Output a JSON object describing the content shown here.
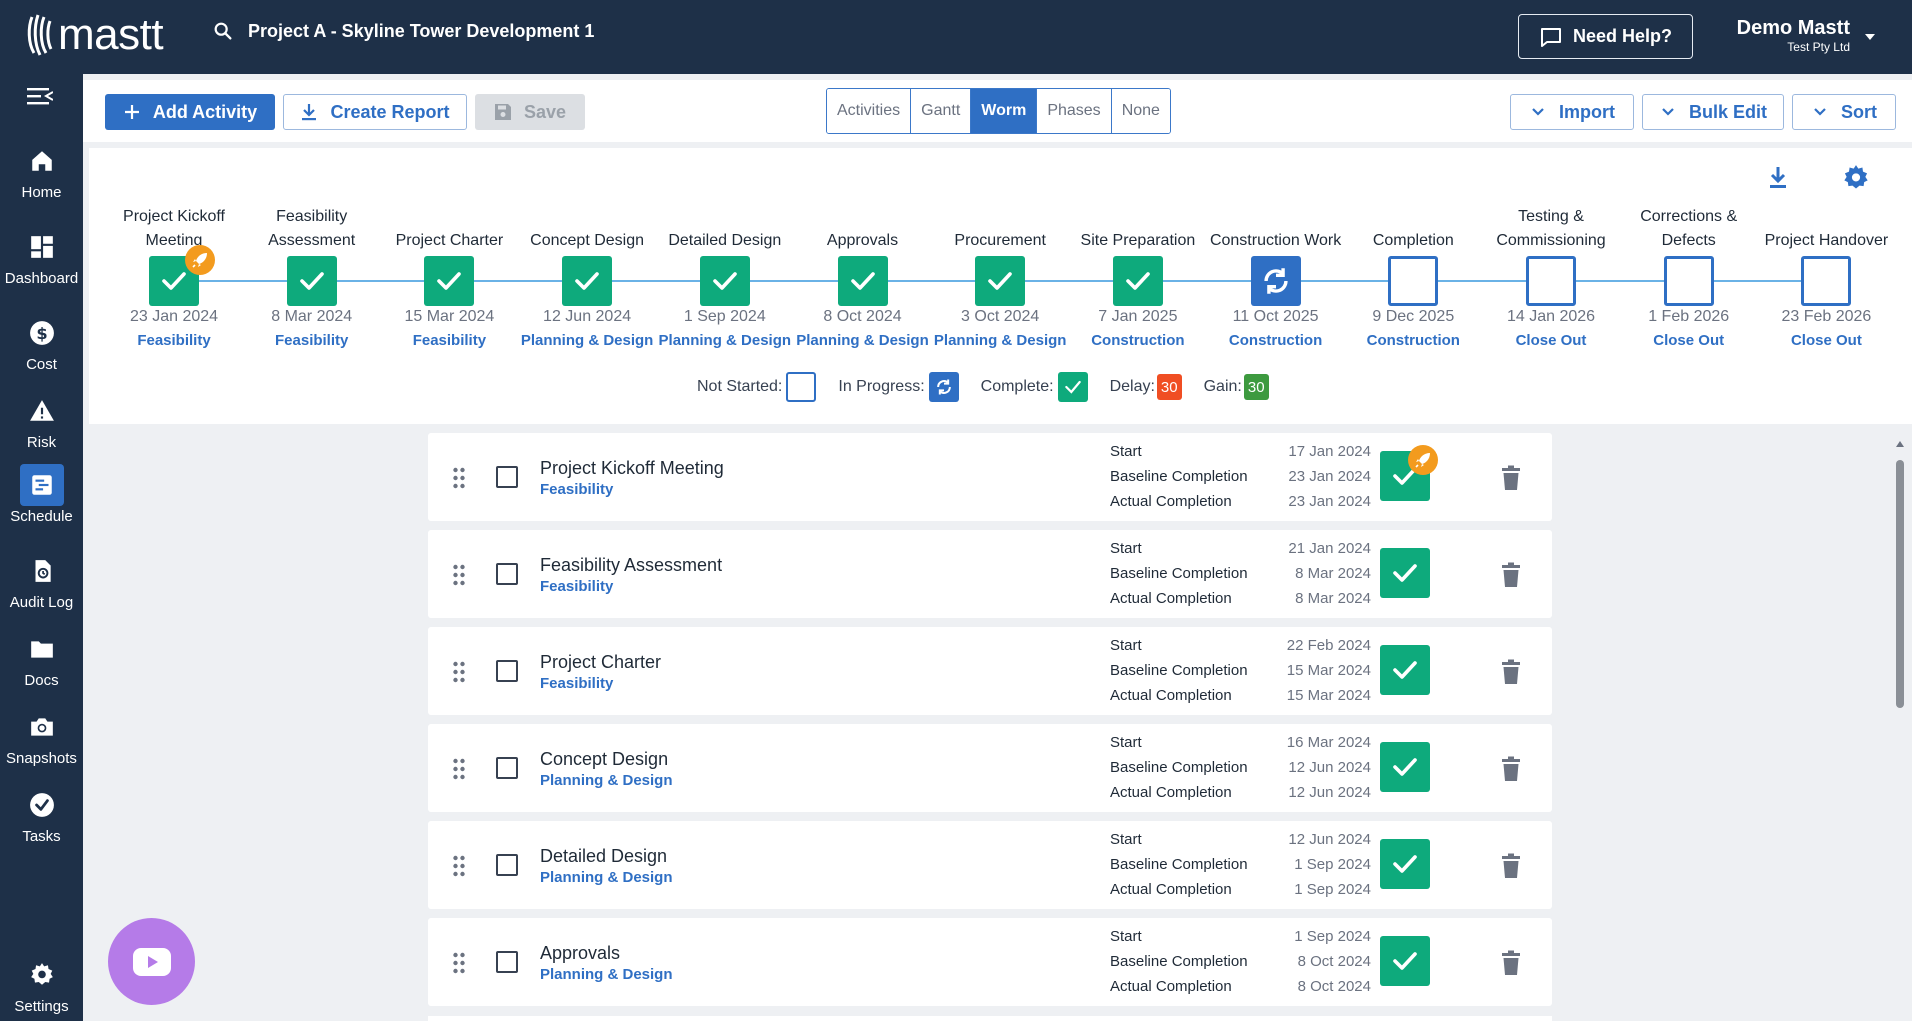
{
  "app": {
    "logo_text": "mastt"
  },
  "header": {
    "project_title": "Project A - Skyline Tower Development 1",
    "help_label": "Need Help?",
    "user_name": "Demo Mastt",
    "user_company": "Test Pty Ltd"
  },
  "sidebar": {
    "items": [
      {
        "label": "Home",
        "icon": "home-icon"
      },
      {
        "label": "Dashboard",
        "icon": "dashboard-icon"
      },
      {
        "label": "Cost",
        "icon": "dollar-icon"
      },
      {
        "label": "Risk",
        "icon": "warning-icon"
      },
      {
        "label": "Schedule",
        "icon": "schedule-icon",
        "active": true
      },
      {
        "label": "Audit Log",
        "icon": "audit-log-icon"
      },
      {
        "label": "Docs",
        "icon": "folder-icon"
      },
      {
        "label": "Snapshots",
        "icon": "camera-icon"
      },
      {
        "label": "Tasks",
        "icon": "check-circle-icon"
      },
      {
        "label": "Settings",
        "icon": "gear-icon"
      }
    ]
  },
  "toolbar": {
    "add_activity": "Add Activity",
    "create_report": "Create Report",
    "save": "Save",
    "views": [
      "Activities",
      "Gantt",
      "Worm",
      "Phases",
      "None"
    ],
    "active_view": "Worm",
    "import": "Import",
    "bulk_edit": "Bulk Edit",
    "sort": "Sort"
  },
  "worm": {
    "milestones": [
      {
        "title": "Project Kickoff Meeting",
        "date": "23 Jan 2024",
        "phase": "Feasibility",
        "status": "complete",
        "rocket": true
      },
      {
        "title": "Feasibility Assessment",
        "date": "8 Mar 2024",
        "phase": "Feasibility",
        "status": "complete"
      },
      {
        "title": "Project Charter",
        "date": "15 Mar 2024",
        "phase": "Feasibility",
        "status": "complete"
      },
      {
        "title": "Concept Design",
        "date": "12 Jun 2024",
        "phase": "Planning & Design",
        "status": "complete"
      },
      {
        "title": "Detailed Design",
        "date": "1 Sep 2024",
        "phase": "Planning & Design",
        "status": "complete"
      },
      {
        "title": "Approvals",
        "date": "8 Oct 2024",
        "phase": "Planning & Design",
        "status": "complete"
      },
      {
        "title": "Procurement",
        "date": "3 Oct 2024",
        "phase": "Planning & Design",
        "status": "complete"
      },
      {
        "title": "Site Preparation",
        "date": "7 Jan 2025",
        "phase": "Construction",
        "status": "complete"
      },
      {
        "title": "Construction Work",
        "date": "11 Oct 2025",
        "phase": "Construction",
        "status": "in-progress"
      },
      {
        "title": "Completion",
        "date": "9 Dec 2025",
        "phase": "Construction",
        "status": "not-started"
      },
      {
        "title": "Testing & Commissioning",
        "date": "14 Jan 2026",
        "phase": "Close Out",
        "status": "not-started"
      },
      {
        "title": "Corrections & Defects",
        "date": "1 Feb 2026",
        "phase": "Close Out",
        "status": "not-started"
      },
      {
        "title": "Project Handover",
        "date": "23 Feb 2026",
        "phase": "Close Out",
        "status": "not-started"
      }
    ],
    "legend": {
      "not_started": "Not Started:",
      "in_progress": "In Progress:",
      "complete": "Complete:",
      "delay": "Delay:",
      "delay_value": "30",
      "gain": "Gain:",
      "gain_value": "30"
    },
    "colors": {
      "complete": "#0eaa7c",
      "in_progress": "#2f6fc4",
      "delay": "#f04e23",
      "gain": "#3d9a3f",
      "rocket": "#f39b1e"
    }
  },
  "activities": [
    {
      "name": "Project Kickoff Meeting",
      "phase": "Feasibility",
      "start": "17 Jan 2024",
      "baseline": "23 Jan 2024",
      "actual": "23 Jan 2024",
      "rocket": true
    },
    {
      "name": "Feasibility Assessment",
      "phase": "Feasibility",
      "start": "21 Jan 2024",
      "baseline": "8 Mar 2024",
      "actual": "8 Mar 2024"
    },
    {
      "name": "Project Charter",
      "phase": "Feasibility",
      "start": "22 Feb 2024",
      "baseline": "15 Mar 2024",
      "actual": "15 Mar 2024"
    },
    {
      "name": "Concept Design",
      "phase": "Planning & Design",
      "start": "16 Mar 2024",
      "baseline": "12 Jun 2024",
      "actual": "12 Jun 2024"
    },
    {
      "name": "Detailed Design",
      "phase": "Planning & Design",
      "start": "12 Jun 2024",
      "baseline": "1 Sep 2024",
      "actual": "1 Sep 2024"
    },
    {
      "name": "Approvals",
      "phase": "Planning & Design",
      "start": "1 Sep 2024",
      "baseline": "8 Oct 2024",
      "actual": "8 Oct 2024"
    }
  ],
  "activity_labels": {
    "start": "Start",
    "baseline": "Baseline Completion",
    "actual": "Actual Completion"
  }
}
